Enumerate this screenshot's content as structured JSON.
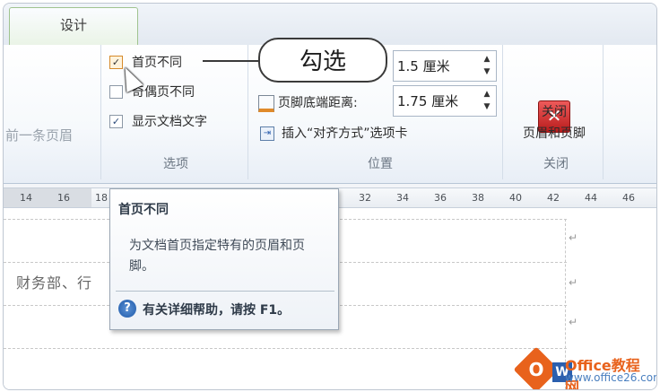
{
  "tabs": {
    "design": "设计"
  },
  "ribbon": {
    "navigation_faded": "前一条页眉",
    "options": {
      "first_page_diff": "首页不同",
      "odd_even_diff": "奇偶页不同",
      "show_doc_text": "显示文档文字",
      "group_label": "选项",
      "first_page_checked": true,
      "odd_even_checked": false,
      "show_doc_text_checked": true
    },
    "position": {
      "header_value": "1.5 厘米",
      "footer_label": "页脚底端距离:",
      "footer_value": "1.75 厘米",
      "insert_align_tab": "插入“对齐方式”选项卡",
      "group_label": "位置"
    },
    "close": {
      "label_line1": "关闭",
      "label_line2": "页眉和页脚",
      "group_label": "关闭",
      "icon": "close-x-icon"
    }
  },
  "callout": {
    "text": "勾选"
  },
  "ruler": {
    "ticks": [
      "14",
      "16",
      "18",
      "32",
      "34",
      "36",
      "38",
      "40",
      "42",
      "44",
      "46"
    ]
  },
  "document": {
    "line_text": "财务部、行",
    "paragraph_mark": "↵"
  },
  "tooltip": {
    "title": "首页不同",
    "body": "为文档首页指定特有的页眉和页脚。",
    "help": "有关详细帮助，请按 F1。",
    "help_icon": "?"
  },
  "watermark": {
    "brand": "Office教程网",
    "url": "www.office26.com"
  },
  "colors": {
    "accent_green": "#9fc38f",
    "close_red": "#d23030",
    "watermark_orange": "#e8621c"
  }
}
